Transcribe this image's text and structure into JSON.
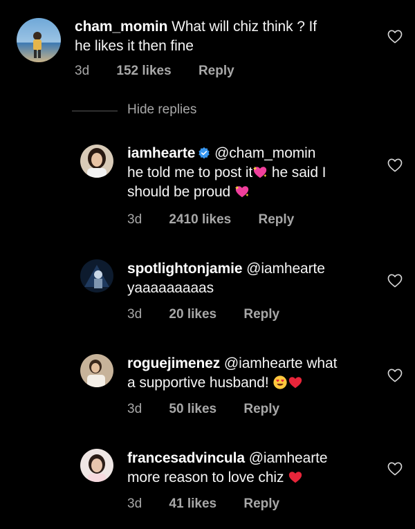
{
  "colors": {
    "background": "#000000",
    "text": "#f5f5f5",
    "secondary": "#a8a8a8",
    "verified": "#3897f0",
    "heart_emoji": "#e8253a"
  },
  "top_comment": {
    "username": "cham_momin",
    "text_line1": " What will chiz think ? If",
    "text_line2": "he likes it then fine",
    "time": "3d",
    "likes": "152 likes",
    "reply": "Reply"
  },
  "hide_replies": "Hide replies",
  "replies": [
    {
      "username": "iamhearte",
      "verified": true,
      "line1": " @cham_momin",
      "line2_a": "he told me to post it",
      "line2_emoji": "sparkling-heart-emoji",
      "line2_b": " he said I",
      "line3_a": "should be proud ",
      "line3_emoji": "sparkling-heart-emoji",
      "time": "3d",
      "likes": "2410 likes",
      "reply": "Reply"
    },
    {
      "username": "spotlightonjamie",
      "line1": " @iamhearte",
      "line2": "yaaaaaaaaas",
      "time": "3d",
      "likes": "20 likes",
      "reply": "Reply"
    },
    {
      "username": "roguejimenez",
      "line1": " @iamhearte what",
      "line2": "a supportive husband! ",
      "line2_emojis": [
        "heart-eyes-emoji",
        "red-heart-emoji"
      ],
      "time": "3d",
      "likes": "50 likes",
      "reply": "Reply"
    },
    {
      "username": "francesadvincula",
      "line1": " @iamhearte",
      "line2": "more reason to love chiz ",
      "line2_emoji": "red-heart-emoji",
      "time": "3d",
      "likes": "41 likes",
      "reply": "Reply"
    }
  ],
  "icons": {
    "like": "heart-outline-icon",
    "verified": "verified-badge-icon"
  }
}
